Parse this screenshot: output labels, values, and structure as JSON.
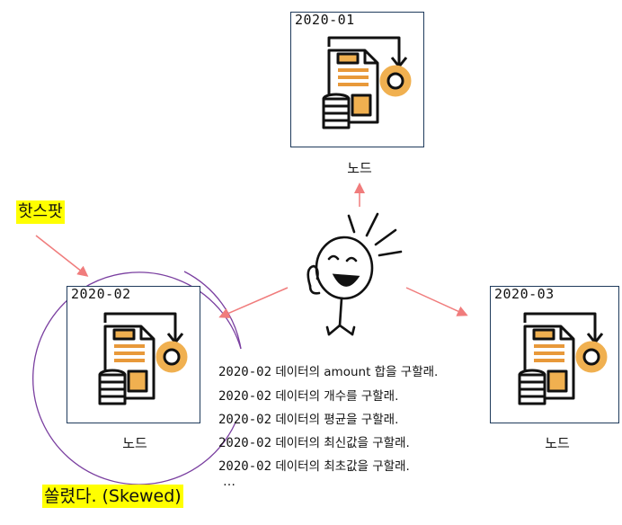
{
  "nodes": [
    {
      "date": "2020-01",
      "label": "노드"
    },
    {
      "date": "2020-02",
      "label": "노드"
    },
    {
      "date": "2020-03",
      "label": "노드"
    }
  ],
  "hotspot": "핫스팟",
  "skewed": "쏠렸다. (Skewed)",
  "ellipsis": "…",
  "queries": [
    {
      "date": "2020-02",
      "text": "데이터의 amount 합을 구할래."
    },
    {
      "date": "2020-02",
      "text": "데이터의 개수를 구할래."
    },
    {
      "date": "2020-02",
      "text": "데이터의 평균을 구할래."
    },
    {
      "date": "2020-02",
      "text": "데이터의 최신값을 구할래."
    },
    {
      "date": "2020-02",
      "text": "데이터의 최초값을 구할래."
    }
  ],
  "colors": {
    "arrow": "#f07c7c",
    "circle": "#7a3fa0",
    "box_border": "#1f3b5c",
    "icon_orange": "#f0b050",
    "icon_stripe": "#e8993a",
    "highlight": "#ffff00"
  },
  "icons": {
    "node": "document-gear-coins-icon",
    "person": "stick-figure-icon"
  }
}
